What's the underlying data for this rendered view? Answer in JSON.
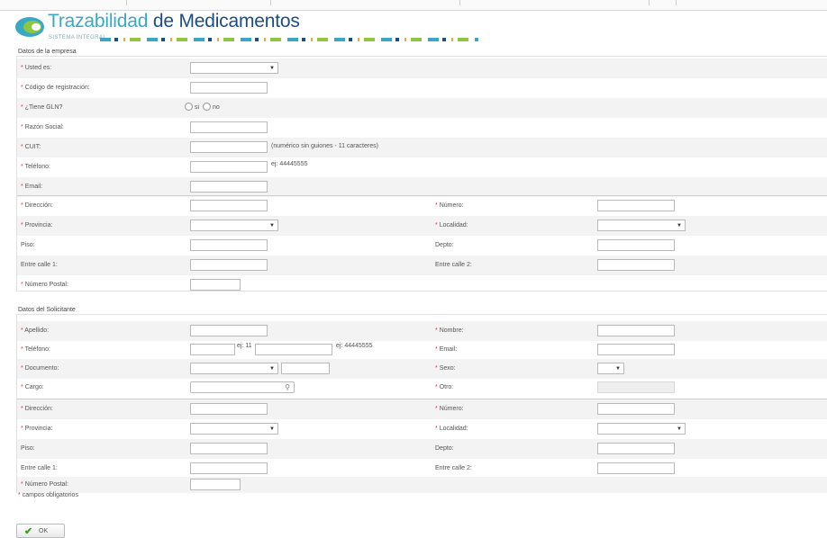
{
  "header": {
    "title_part1": "Trazabilidad",
    "title_part2": "de Medicamentos",
    "subtitle": "SISTEMA INTEGRAL"
  },
  "colors": {
    "accent": "#38a9c4",
    "brand": "#1b4e86",
    "ok": "#3a9d23",
    "required": "#d33333"
  },
  "empresa": {
    "legend": "Datos de la empresa",
    "usted_es": "Usted es:",
    "codigo": "Código de registración:",
    "tiene_gln": "¿Tiene GLN?",
    "gln_si": "si",
    "gln_no": "no",
    "razon_social": "Razón Social:",
    "cuit": "CUIT:",
    "cuit_hint": "(numérico sin guiones - 11 caracteres)",
    "telefono": "Teléfono:",
    "telefono_hint": "ej: 44445555",
    "email": "Email:",
    "direccion": "Dirección:",
    "numero": "Número:",
    "provincia": "Provincia:",
    "localidad": "Localidad:",
    "piso": "Piso:",
    "depto": "Depto:",
    "entre_calle1": "Entre calle 1:",
    "entre_calle2": "Entre calle 2:",
    "numero_postal": "Número Postal:"
  },
  "solicitante": {
    "legend": "Datos del Solicitante",
    "apellido": "Apellido:",
    "nombre": "Nombre:",
    "telefono": "Teléfono:",
    "telefono_area_hint": "ej: 11",
    "telefono_hint": "ej: 44445555",
    "email": "Email:",
    "documento": "Documento:",
    "sexo": "Sexo:",
    "cargo": "Cargo:",
    "otro": "Otro:",
    "direccion": "Dirección:",
    "numero": "Número:",
    "provincia": "Provincia:",
    "localidad": "Localidad:",
    "piso": "Piso:",
    "depto": "Depto:",
    "entre_calle1": "Entre calle 1:",
    "entre_calle2": "Entre calle 2:",
    "numero_postal": "Número Postal:"
  },
  "footer": {
    "required_mark": "*",
    "required_note": "campos obligatorios",
    "ok_label": "OK"
  },
  "icons": {
    "ok": "check-icon",
    "search": "search-icon",
    "dropdown": "chevron-down-icon"
  }
}
